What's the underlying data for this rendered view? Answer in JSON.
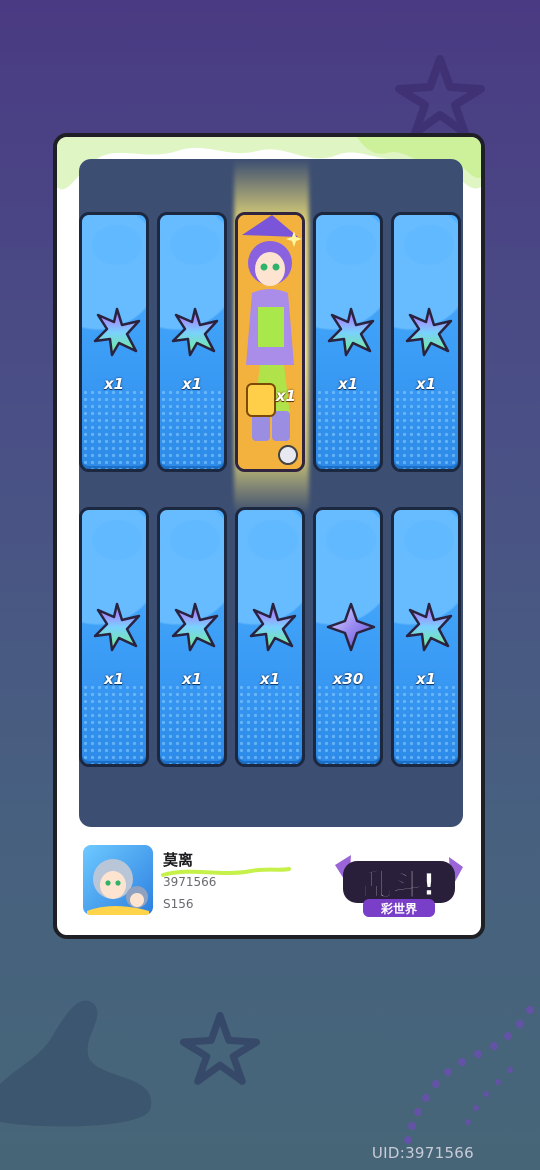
{
  "card": {
    "rewards_row1": [
      {
        "item": "rainbow-crystal",
        "qty": "x1"
      },
      {
        "item": "rainbow-crystal",
        "qty": "x1"
      },
      {
        "item": "character-card",
        "qty": "x1"
      },
      {
        "item": "rainbow-crystal",
        "qty": "x1"
      },
      {
        "item": "rainbow-crystal",
        "qty": "x1"
      }
    ],
    "rewards_row2": [
      {
        "item": "rainbow-crystal",
        "qty": "x1"
      },
      {
        "item": "rainbow-crystal",
        "qty": "x1"
      },
      {
        "item": "rainbow-crystal",
        "qty": "x1"
      },
      {
        "item": "star-shard",
        "qty": "x30"
      },
      {
        "item": "rainbow-crystal",
        "qty": "x1"
      }
    ]
  },
  "player": {
    "name": "莫离",
    "id": "3971566",
    "server": "S156"
  },
  "logo": {
    "main": "乱斗!",
    "sub": "彩世界"
  },
  "uid_label": "UID:3971566",
  "colors": {
    "slot_blue": "#3a9bf5",
    "highlight_gold": "#f7c84f",
    "frame_dark": "#1f1f26",
    "background_top": "#4a3a83"
  }
}
